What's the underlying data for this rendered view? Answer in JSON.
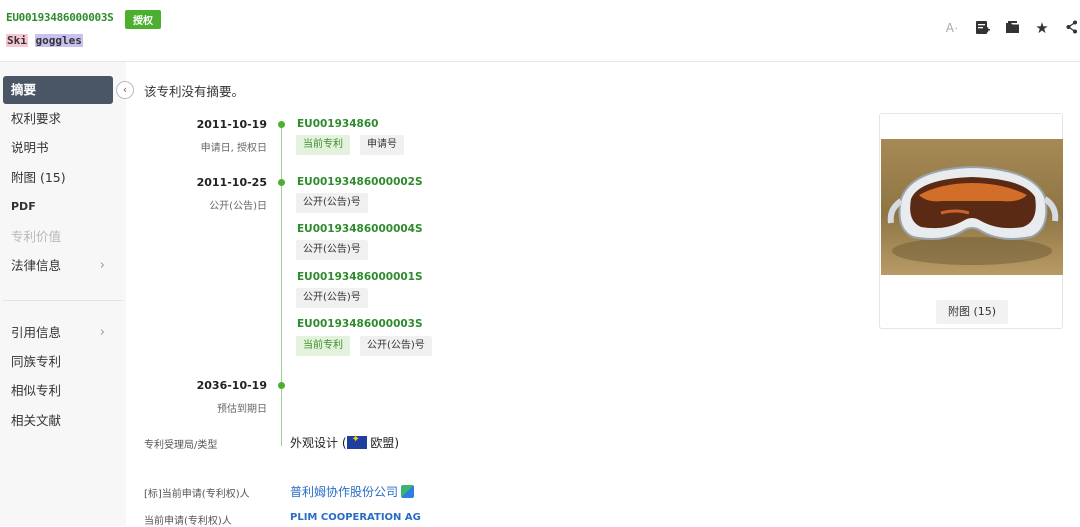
{
  "header": {
    "pub_number": "EU00193486000003S",
    "status": "授权",
    "title_words": [
      "Ski",
      "goggles"
    ],
    "tools": [
      "font-size-icon",
      "add-note-icon",
      "folder-icon",
      "star-icon",
      "share-icon"
    ]
  },
  "sidebar": {
    "items": [
      {
        "label": "摘要",
        "state": "active"
      },
      {
        "label": "权利要求"
      },
      {
        "label": "说明书"
      },
      {
        "label": "附图 (15)"
      },
      {
        "label": "PDF"
      },
      {
        "label": "专利价值",
        "state": "disabled"
      },
      {
        "label": "法律信息",
        "chevron": "›"
      },
      {
        "label": "引用信息",
        "chevron": "›"
      },
      {
        "label": "同族专利"
      },
      {
        "label": "相似专利"
      },
      {
        "label": "相关文献"
      }
    ],
    "collapse_icon": "‹"
  },
  "main": {
    "no_abstract": "该专利没有摘要。",
    "timeline": [
      {
        "date": "2011-10-19",
        "sub": "申请日, 授权日",
        "entries": [
          {
            "number": "EU001934860",
            "tags": [
              {
                "label": "当前专利",
                "style": "green"
              },
              {
                "label": "申请号"
              }
            ]
          }
        ]
      },
      {
        "date": "2011-10-25",
        "sub": "公开(公告)日",
        "entries": [
          {
            "number": "EU00193486000002S",
            "tags": [
              {
                "label": "公开(公告)号"
              }
            ]
          },
          {
            "number": "EU00193486000004S",
            "tags": [
              {
                "label": "公开(公告)号"
              }
            ]
          },
          {
            "number": "EU00193486000001S",
            "tags": [
              {
                "label": "公开(公告)号"
              }
            ]
          },
          {
            "number": "EU00193486000003S",
            "tags": [
              {
                "label": "当前专利",
                "style": "green"
              },
              {
                "label": "公开(公告)号"
              }
            ]
          }
        ]
      },
      {
        "date": "2036-10-19",
        "sub": "预估到期日",
        "entries": []
      }
    ],
    "figure_button": "附图 (15)",
    "fields": [
      {
        "label": "专利受理局/类型",
        "value": "外观设计 (",
        "value_suffix": " 欧盟)"
      },
      {
        "label": "[标]当前申请(专利权)人",
        "value": "普利姆协作股份公司"
      },
      {
        "label": "当前申请(专利权)人",
        "value": "PLIM COOPERATION AG"
      }
    ]
  },
  "colors": {
    "accent_green": "#4caf2e",
    "link_blue": "#2a6cc6",
    "nav_active": "#4a5566"
  }
}
